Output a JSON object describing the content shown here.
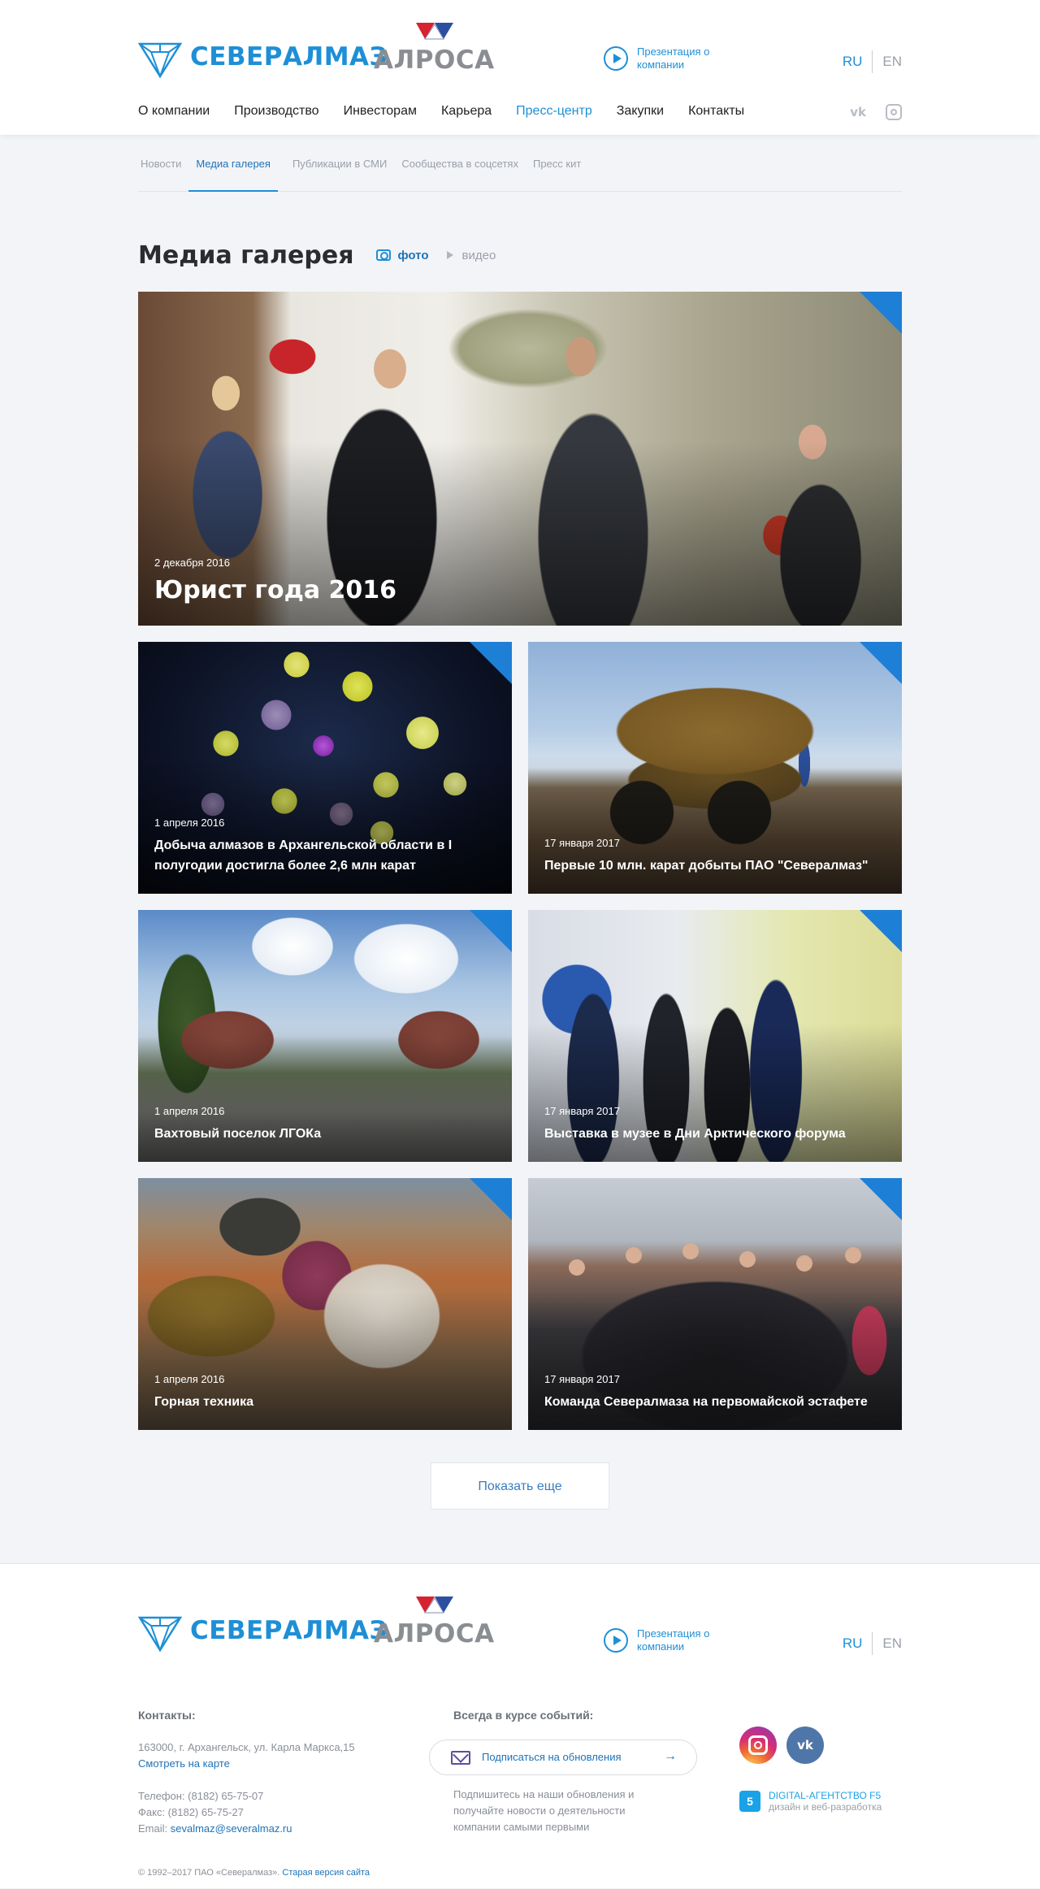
{
  "header": {
    "logo_text": "СЕВЕРАЛМАЗ",
    "alrosa_text": "АЛРОСА",
    "presentation": "Презентация о компании",
    "lang_ru": "RU",
    "lang_en": "EN",
    "nav": [
      "О компании",
      "Производство",
      "Инвесторам",
      "Карьера",
      "Пресс-центр",
      "Закупки",
      "Контакты"
    ],
    "nav_active": "Пресс-центр",
    "vk_text": "vk"
  },
  "subnav": {
    "items": [
      "Новости",
      "Медиа галерея",
      "Публикации в СМИ",
      "Сообщества в соцсетях",
      "Пресс кит"
    ],
    "active": "Медиа галерея"
  },
  "page": {
    "title": "Медиа галерея",
    "tab_photo": "фото",
    "tab_video": "видео"
  },
  "gallery": [
    {
      "date": "2 декабря 2016",
      "caption": "Юрист года 2016"
    },
    {
      "date": "1 апреля 2016",
      "caption": "Добыча алмазов в Архангельской области в I полугодии достигла более 2,6 млн карат"
    },
    {
      "date": "17 января 2017",
      "caption": "Первые 10 млн. карат добыты ПАО \"Севералмаз\""
    },
    {
      "date": "1 апреля 2016",
      "caption": "Вахтовый поселок ЛГОКа"
    },
    {
      "date": "17 января 2017",
      "caption": "Выставка в музее в Дни Арктического форума"
    },
    {
      "date": "1 апреля 2016",
      "caption": "Горная техника"
    },
    {
      "date": "17 января 2017",
      "caption": "Команда Севералмаза на первомайской эстафете"
    }
  ],
  "more_button": "Показать еще",
  "footer": {
    "contacts_title": "Контакты:",
    "address": "163000, г. Архангельск, ул. Карла Маркса,15",
    "map_link": "Смотреть на карте",
    "phone": "Телефон: (8182) 65-75-07",
    "fax": "Факс: (8182) 65-75-27",
    "email_label": "Email:",
    "email": "sevalmaz@severalmaz.ru",
    "news_title": "Всегда в курсе событий:",
    "subscribe": "Подписаться на обновления",
    "subscribe_arrow": "→",
    "subscribe_note": "Подпишитесь на наши обновления и получайте новости о деятельности компании самыми первыми",
    "f5_icon": "5",
    "f5_title": "DIGITAL-АГЕНТСТВО F5",
    "f5_sub": "дизайн и веб-разработка",
    "copyright": "© 1992–2017 ПАО «Севералмаз».",
    "old_site": "Старая версия сайта"
  }
}
